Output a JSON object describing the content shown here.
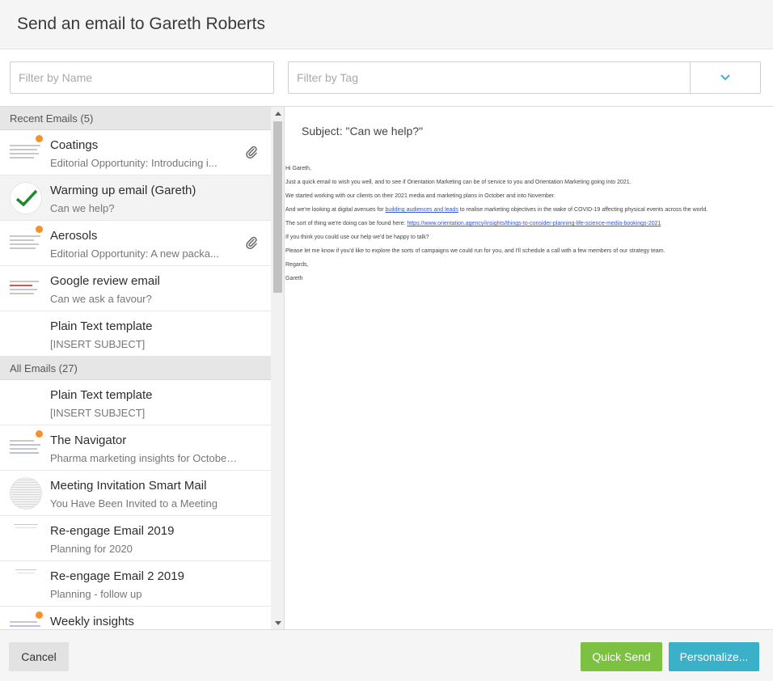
{
  "header": {
    "title": "Send an email to Gareth Roberts"
  },
  "filters": {
    "name_placeholder": "Filter by Name",
    "tag_placeholder": "Filter by Tag"
  },
  "recent": {
    "header": "Recent Emails (5)",
    "items": [
      {
        "title": "Coatings",
        "subtitle": "Editorial Opportunity: Introducing i...",
        "thumb": "doc-thumb-dot",
        "attachment": true
      },
      {
        "title": "Warming up email (Gareth)",
        "subtitle": "Can we help?",
        "thumb": "check-thumb",
        "attachment": false,
        "selected": true
      },
      {
        "title": "Aerosols",
        "subtitle": "Editorial Opportunity: A new packa...",
        "thumb": "doc-thumb-dot",
        "attachment": true
      },
      {
        "title": "Google review email",
        "subtitle": "Can we ask a favour?",
        "thumb": "doc-thumb-red",
        "attachment": false
      },
      {
        "title": "Plain Text template",
        "subtitle": "[INSERT SUBJECT]",
        "thumb": "none",
        "attachment": false
      }
    ]
  },
  "all": {
    "header": "All Emails (27)",
    "items": [
      {
        "title": "Plain Text template",
        "subtitle": "[INSERT SUBJECT]",
        "thumb": "none"
      },
      {
        "title": "The Navigator",
        "subtitle": "Pharma marketing insights for October...",
        "thumb": "doc-thumb-dot"
      },
      {
        "title": "Meeting Invitation Smart Mail",
        "subtitle": "You Have Been Invited to a Meeting",
        "thumb": "circle-thumb"
      },
      {
        "title": "Re-engage Email 2019",
        "subtitle": "Planning for 2020",
        "thumb": "faint-thumb"
      },
      {
        "title": "Re-engage Email 2 2019",
        "subtitle": "Planning - follow up",
        "thumb": "faint-thumb"
      },
      {
        "title": "Weekly insights",
        "subtitle": "",
        "thumb": "doc-thumb-dot"
      }
    ]
  },
  "preview": {
    "subject": "Subject: \"Can we help?\"",
    "greeting": "Hi Gareth,",
    "line1": "Just a quick email to wish you well, and to see if Orientation Marketing can be of service to you and Orientation Marketing going into 2021.",
    "line2": "We started working with our clients on their 2021 media and marketing plans in October and into November.",
    "line3_pre": "And we're looking at digital avenues for ",
    "line3_link": "building audiences and leads",
    "line3_post": " to realise marketing objectives in the wake of COVID-19 affecting physical events across the world.",
    "line4_pre": "The sort of thing we're doing can be found here: ",
    "line4_link": "https://www.orientation.agency/insights/things-to-consider-planning-life-science-media-bookings-2021",
    "line5": "If you think you could use our help we'd be happy to talk?",
    "line6": "Please let me know if you'd like to explore the sorts of campaigns we could run for you, and I'll schedule a call with a few members of our strategy team.",
    "signoff": "Regards,",
    "signature": "Gareth"
  },
  "footer": {
    "cancel_label": "Cancel",
    "quick_send_label": "Quick Send",
    "personalize_label": "Personalize..."
  },
  "colors": {
    "quick_send": "#7cc142",
    "personalize": "#3ab0c9",
    "dropdown_chevron": "#3ab0c9",
    "notification_dot": "#f4922a",
    "checkmark": "#1e8a2e"
  }
}
